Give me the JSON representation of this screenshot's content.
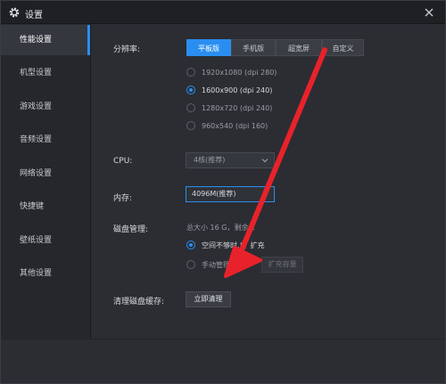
{
  "window": {
    "title": "设置"
  },
  "sidebar": {
    "items": [
      {
        "label": "性能设置",
        "active": true
      },
      {
        "label": "机型设置"
      },
      {
        "label": "游戏设置"
      },
      {
        "label": "音频设置"
      },
      {
        "label": "网络设置"
      },
      {
        "label": "快捷键"
      },
      {
        "label": "壁纸设置"
      },
      {
        "label": "其他设置"
      }
    ]
  },
  "resolution": {
    "label": "分辨率:",
    "tabs": [
      "平板版",
      "手机版",
      "超宽屏",
      "自定义"
    ],
    "active_tab": "平板版",
    "options": [
      "1920x1080 (dpi 280)",
      "1600x900 (dpi 240)",
      "1280x720 (dpi 240)",
      "960x540 (dpi 160)"
    ],
    "selected": "1600x900 (dpi 240)"
  },
  "cpu": {
    "label": "CPU:",
    "value": "4核(推荐)"
  },
  "memory": {
    "label": "内存:",
    "value": "4096M(推荐)"
  },
  "disk": {
    "label": "磁盘管理:",
    "summary": "总大小 16 G，剩余 1",
    "option_auto": "空间不够时,自",
    "option_auto_tail": "扩充",
    "option_manual": "手动管理磁",
    "expand_button": "扩充容量"
  },
  "cache": {
    "label": "清理磁盘缓存:",
    "button": "立即清理"
  },
  "colors": {
    "accent": "#2a8ef0",
    "arrow": "#e8222a"
  }
}
